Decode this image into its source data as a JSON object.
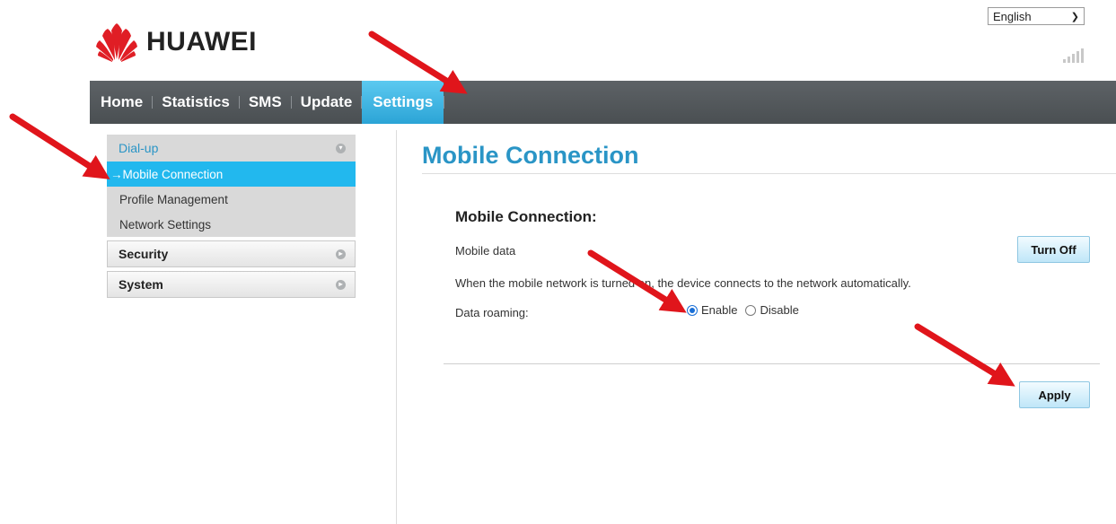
{
  "header": {
    "brand": "HUAWEI",
    "language": "English",
    "signal_icon": "signal-bars-icon"
  },
  "nav": {
    "items": [
      {
        "label": "Home",
        "active": false
      },
      {
        "label": "Statistics",
        "active": false
      },
      {
        "label": "SMS",
        "active": false
      },
      {
        "label": "Update",
        "active": false
      },
      {
        "label": "Settings",
        "active": true
      }
    ]
  },
  "sidebar": {
    "groups": [
      {
        "label": "Dial-up",
        "expanded": true,
        "items": [
          {
            "label": "Mobile Connection",
            "active": true
          },
          {
            "label": "Profile Management",
            "active": false
          },
          {
            "label": "Network Settings",
            "active": false
          }
        ]
      },
      {
        "label": "Security",
        "expanded": false
      },
      {
        "label": "System",
        "expanded": false
      }
    ],
    "active_arrow": "→"
  },
  "main": {
    "page_title": "Mobile Connection",
    "section_title": "Mobile Connection:",
    "mobile_data_label": "Mobile data",
    "turn_off_button": "Turn Off",
    "description": "When the mobile network is turned on, the device connects to the network automatically.",
    "roaming_label": "Data roaming:",
    "roaming_options": [
      {
        "label": "Enable",
        "selected": true
      },
      {
        "label": "Disable",
        "selected": false
      }
    ],
    "apply_button": "Apply"
  },
  "colors": {
    "accent": "#2a95c6",
    "nav_active": "#2ba4d6",
    "annotation_arrow": "#e0151b"
  }
}
